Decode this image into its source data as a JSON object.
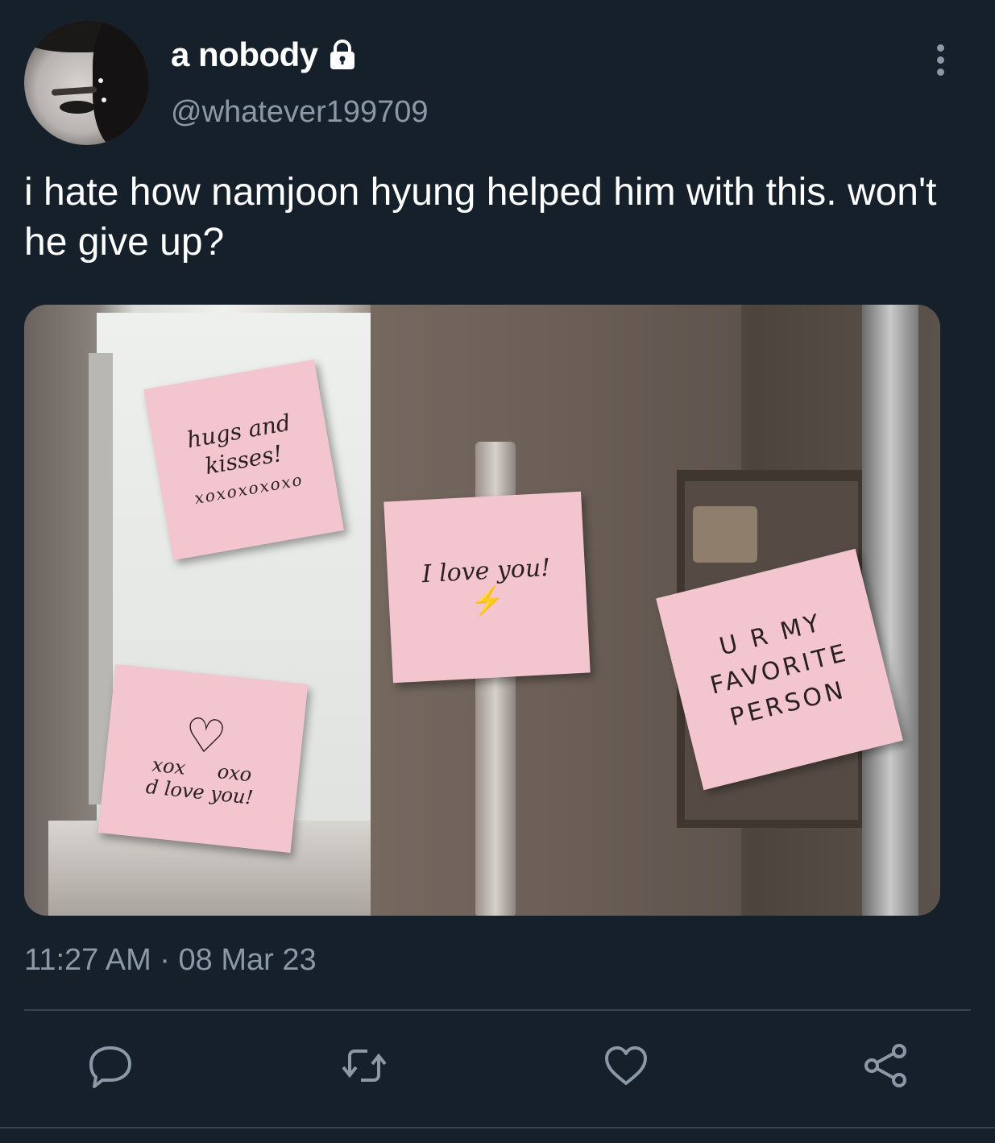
{
  "user": {
    "display_name": "a nobody",
    "handle": "@whatever199709",
    "protected_icon": "lock-icon"
  },
  "tweet": {
    "text": "i hate how namjoon hyung helped him with this. won't he give up?",
    "timestamp": "11:27 AM · 08 Mar 23"
  },
  "media": {
    "notes": [
      {
        "line1": "hugs and",
        "line2": "kisses!",
        "line3": "xoxoxoxoxo"
      },
      {
        "line1": "I love you!"
      },
      {
        "line1": "xox",
        "line2": "oxo",
        "line3": "d love you!"
      },
      {
        "line1": "U R MY",
        "line2": "FAVORITE",
        "line3": "PERSON"
      }
    ]
  },
  "actions": {
    "reply_icon": "comment-icon",
    "retweet_icon": "retweet-icon",
    "like_icon": "heart-icon",
    "share_icon": "share-icon"
  },
  "colors": {
    "background": "#15202b",
    "secondary_text": "#8b98a5",
    "divider": "#38444d"
  }
}
